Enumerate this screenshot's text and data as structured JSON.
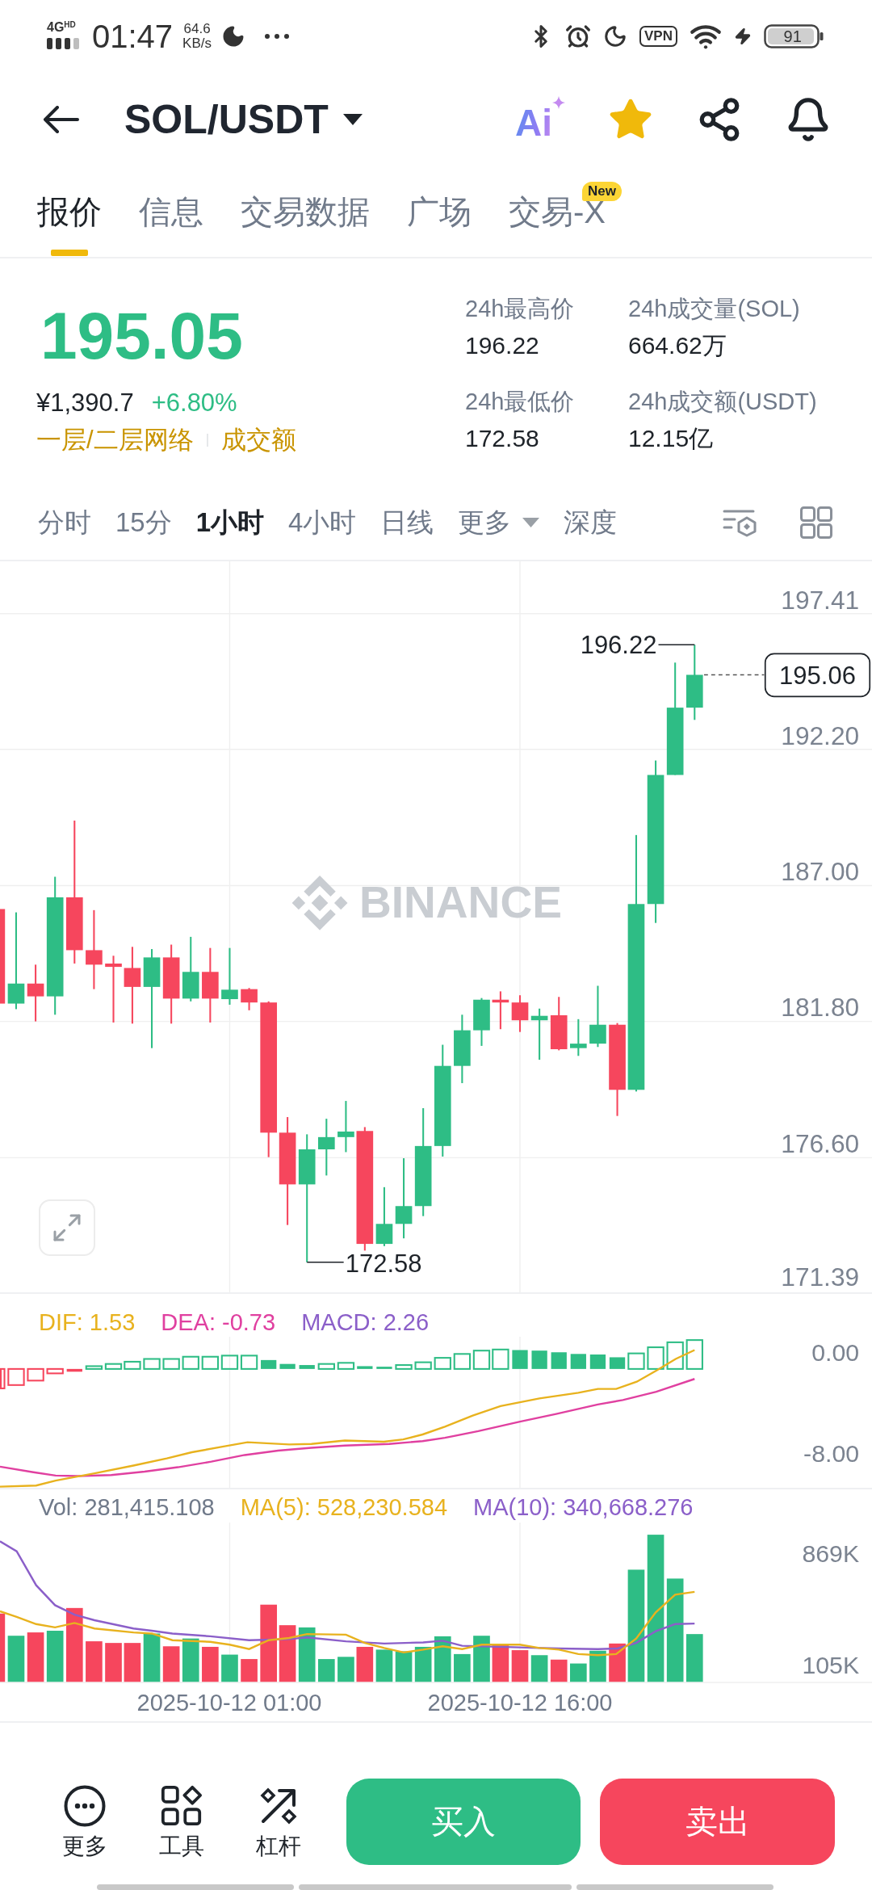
{
  "status_bar": {
    "network": "4G$^{HD}$",
    "time": "01:47",
    "speed": "64.6",
    "speed_unit": "KB/s",
    "vpn": "VPN",
    "battery": "91"
  },
  "header": {
    "title": "SOL/USDT",
    "ai_label": "Ai",
    "favorite": true
  },
  "tabs": [
    {
      "label": "报价",
      "selected": true
    },
    {
      "label": "信息",
      "selected": false
    },
    {
      "label": "交易数据",
      "selected": false
    },
    {
      "label": "广场",
      "selected": false
    },
    {
      "label": "交易-X",
      "selected": false,
      "badge": "New"
    }
  ],
  "ticker": {
    "last_price": "195.05",
    "rising": true,
    "cny_price": "¥1,390.7",
    "change": "+6.80%",
    "links": [
      "一层/二层网络",
      "成交额"
    ]
  },
  "stats": [
    {
      "label": "24h最高价",
      "value": "196.22"
    },
    {
      "label": "24h成交量(SOL)",
      "value": "664.62万"
    },
    {
      "label": "24h最低价",
      "value": "172.58"
    },
    {
      "label": "24h成交额(USDT)",
      "value": "12.15亿"
    }
  ],
  "intervals": [
    {
      "label": "分时",
      "selected": false,
      "kind": "option"
    },
    {
      "label": "15分",
      "selected": false,
      "kind": "option"
    },
    {
      "label": "1小时",
      "selected": true,
      "kind": "option"
    },
    {
      "label": "4小时",
      "selected": false,
      "kind": "option"
    },
    {
      "label": "日线",
      "selected": false,
      "kind": "option"
    },
    {
      "label": "更多",
      "selected": false,
      "kind": "dropdown"
    },
    {
      "label": "深度",
      "selected": false,
      "kind": "option"
    }
  ],
  "chart": {
    "watermark": "BINANCE",
    "price_ticks": [
      "197.41",
      "192.20",
      "187.00",
      "181.80",
      "176.60",
      "171.39"
    ],
    "high_label": "196.22",
    "low_label": "172.58",
    "last_price_tag": "195.06"
  },
  "macd": {
    "legend": [
      {
        "label": "DIF: 1.53",
        "color": "#e8b21e"
      },
      {
        "label": "DEA: -0.73",
        "color": "#e040a0"
      },
      {
        "label": "MACD: 2.26",
        "color": "#8b5fc9"
      }
    ],
    "ticks": [
      "0.00",
      "-8.00"
    ]
  },
  "volume": {
    "legend": [
      {
        "label": "Vol: 281,415.108",
        "color": "#707a8a"
      },
      {
        "label": "MA(5): 528,230.584",
        "color": "#e8b21e"
      },
      {
        "label": "MA(10): 340,668.276",
        "color": "#8b5fc9"
      }
    ],
    "ticks": [
      "869K",
      "105K"
    ]
  },
  "time_axis": [
    "2025-10-12 01:00",
    "2025-10-12 16:00"
  ],
  "actions": [
    {
      "label": "更多",
      "kind": "more"
    },
    {
      "label": "工具",
      "kind": "tools"
    },
    {
      "label": "杠杆",
      "kind": "leverage"
    }
  ],
  "trade_buttons": [
    {
      "label": "买入",
      "kind": "buy"
    },
    {
      "label": "卖出",
      "kind": "sell"
    }
  ]
}
